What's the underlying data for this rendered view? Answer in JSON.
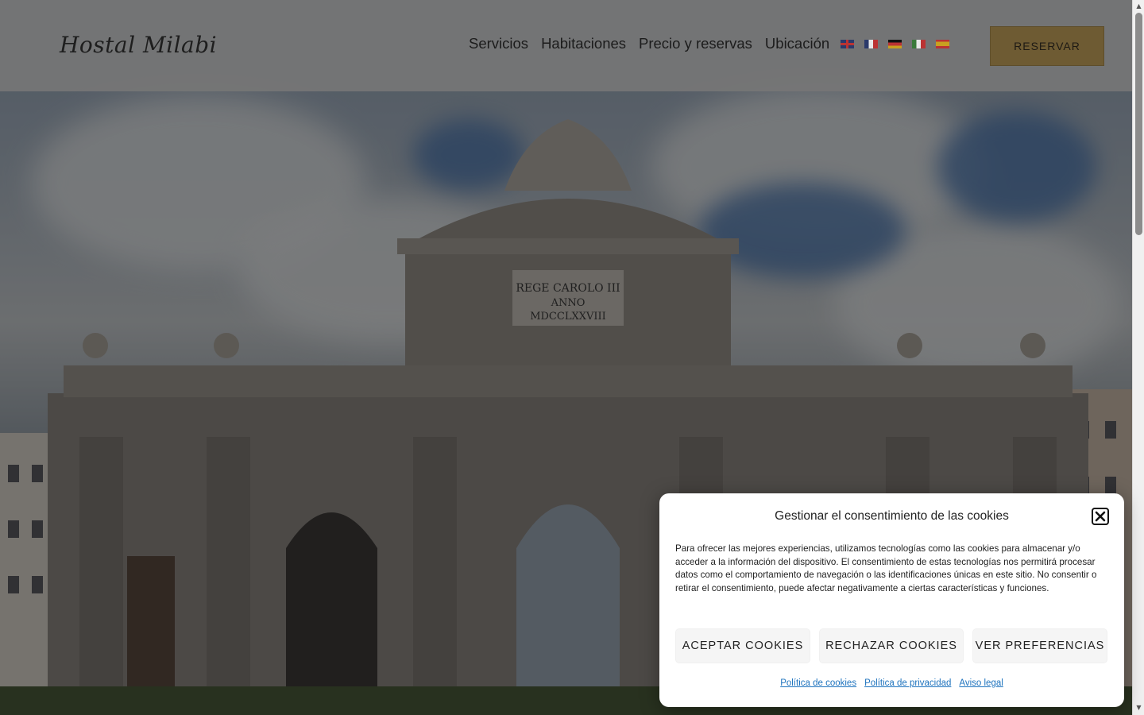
{
  "header": {
    "logo": "Hostal Milabi",
    "nav": [
      {
        "label": "Servicios"
      },
      {
        "label": "Habitaciones"
      },
      {
        "label": "Precio y reservas"
      },
      {
        "label": "Ubicación"
      }
    ],
    "languages": [
      {
        "icon": "flag-uk-icon"
      },
      {
        "icon": "flag-fr-icon"
      },
      {
        "icon": "flag-de-icon"
      },
      {
        "icon": "flag-it-icon"
      },
      {
        "icon": "flag-es-icon"
      }
    ],
    "reserve_label": "RESERVAR"
  },
  "hero": {
    "inscription": [
      "REGE CAROLO III",
      "ANNO",
      "MDCCLXXVIII"
    ]
  },
  "cookie": {
    "title": "Gestionar el consentimiento de las cookies",
    "body": "Para ofrecer las mejores experiencias, utilizamos tecnologías como las cookies para almacenar y/o acceder a la información del dispositivo. El consentimiento de estas tecnologías nos permitirá procesar datos como el comportamiento de navegación o las identificaciones únicas en este sitio. No consentir o retirar el consentimiento, puede afectar negativamente a ciertas características y funciones.",
    "accept_label": "ACEPTAR COOKIES",
    "reject_label": "RECHAZAR COOKIES",
    "prefs_label": "VER PREFERENCIAS",
    "links": [
      {
        "label": "Política de cookies"
      },
      {
        "label": "Política de privacidad"
      },
      {
        "label": "Aviso legal"
      }
    ]
  },
  "colors": {
    "reserve_button": "#6e5b33",
    "link": "#1e73be",
    "header_bg": "#767676"
  }
}
